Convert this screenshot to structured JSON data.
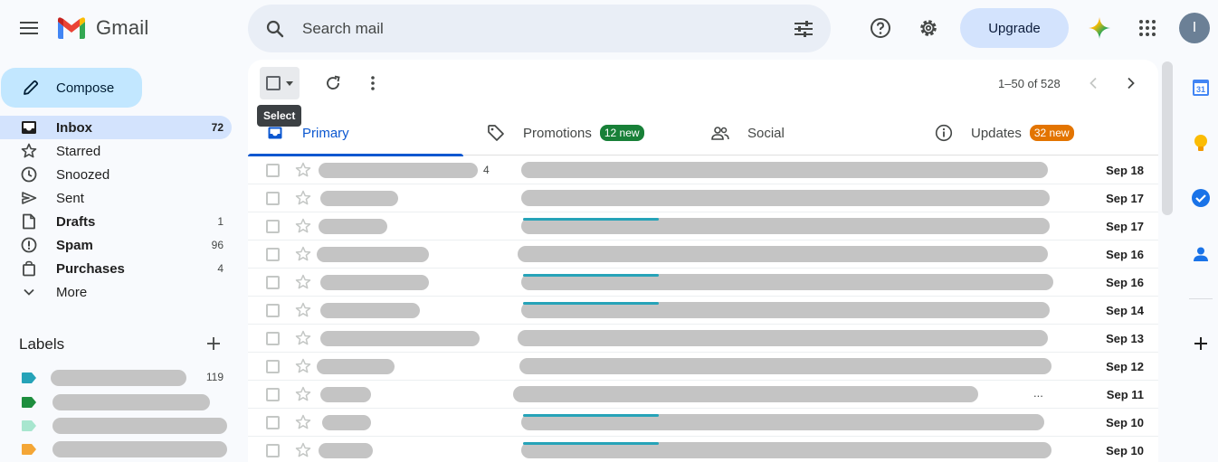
{
  "app": {
    "name": "Gmail"
  },
  "search": {
    "placeholder": "Search mail"
  },
  "header": {
    "upgrade_label": "Upgrade",
    "avatar_initial": "I"
  },
  "compose": {
    "label": "Compose"
  },
  "nav": [
    {
      "id": "inbox",
      "label": "Inbox",
      "count": "72",
      "icon": "inbox-icon",
      "bold": true,
      "active": true
    },
    {
      "id": "starred",
      "label": "Starred",
      "count": "",
      "icon": "star-icon",
      "bold": false
    },
    {
      "id": "snoozed",
      "label": "Snoozed",
      "count": "",
      "icon": "clock-icon",
      "bold": false
    },
    {
      "id": "sent",
      "label": "Sent",
      "count": "",
      "icon": "send-icon",
      "bold": false
    },
    {
      "id": "drafts",
      "label": "Drafts",
      "count": "1",
      "icon": "draft-icon",
      "bold": true
    },
    {
      "id": "spam",
      "label": "Spam",
      "count": "96",
      "icon": "spam-icon",
      "bold": true
    },
    {
      "id": "purchases",
      "label": "Purchases",
      "count": "4",
      "icon": "shopping-bag-icon",
      "bold": true
    },
    {
      "id": "more",
      "label": "More",
      "count": "",
      "icon": "chevron-down-icon",
      "bold": false
    }
  ],
  "labels": {
    "title": "Labels",
    "items": [
      {
        "color": "#26a3b8",
        "count": "119"
      },
      {
        "color": "#1e8e3e",
        "count": ""
      },
      {
        "color": "#a8e6cf",
        "count": ""
      },
      {
        "color": "#f4a636",
        "count": ""
      }
    ]
  },
  "toolbar": {
    "tooltip": "Select",
    "pager": "1–50 of 528"
  },
  "tabs": [
    {
      "id": "primary",
      "label": "Primary",
      "badge": "",
      "icon": "inbox-icon"
    },
    {
      "id": "promotions",
      "label": "Promotions",
      "badge": "12 new",
      "badge_color": "#188038",
      "icon": "tag-icon"
    },
    {
      "id": "social",
      "label": "Social",
      "badge": "",
      "icon": "people-icon"
    },
    {
      "id": "updates",
      "label": "Updates",
      "badge": "32 new",
      "badge_color": "#e37400",
      "icon": "info-icon"
    }
  ],
  "emails": [
    {
      "date": "Sep 18",
      "sender_count": "4"
    },
    {
      "date": "Sep 17",
      "sender_count": ""
    },
    {
      "date": "Sep 17",
      "sender_count": ""
    },
    {
      "date": "Sep 16",
      "sender_count": ""
    },
    {
      "date": "Sep 16",
      "sender_count": ""
    },
    {
      "date": "Sep 14",
      "sender_count": ""
    },
    {
      "date": "Sep 13",
      "sender_count": ""
    },
    {
      "date": "Sep 12",
      "sender_count": ""
    },
    {
      "date": "Sep 11",
      "sender_count": "",
      "ellipsis": "..."
    },
    {
      "date": "Sep 10",
      "sender_count": ""
    },
    {
      "date": "Sep 10",
      "sender_count": ""
    }
  ],
  "side_panel": {
    "calendar_day": "31"
  }
}
